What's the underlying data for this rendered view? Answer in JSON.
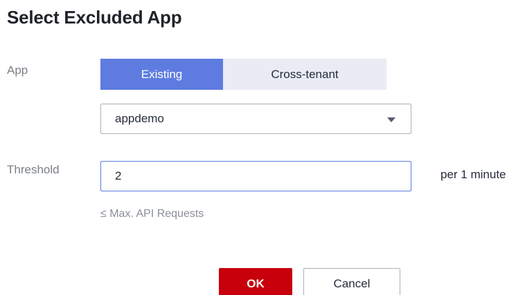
{
  "dialog": {
    "title": "Select Excluded App"
  },
  "form": {
    "app_label": "App",
    "tabs": [
      {
        "label": "Existing",
        "selected": true
      },
      {
        "label": "Cross-tenant",
        "selected": false
      }
    ],
    "app_select_value": "appdemo",
    "threshold_label": "Threshold",
    "threshold_value": "2",
    "threshold_unit": "per 1 minute",
    "threshold_hint": "≤ Max. API Requests"
  },
  "footer": {
    "ok_label": "OK",
    "cancel_label": "Cancel"
  },
  "colors": {
    "accent": "#5e7ce0",
    "tab_unselected": "#e9ecf5",
    "primary_button": "#c7000b"
  },
  "icons": {
    "select_caret": "chevron-down-icon"
  }
}
